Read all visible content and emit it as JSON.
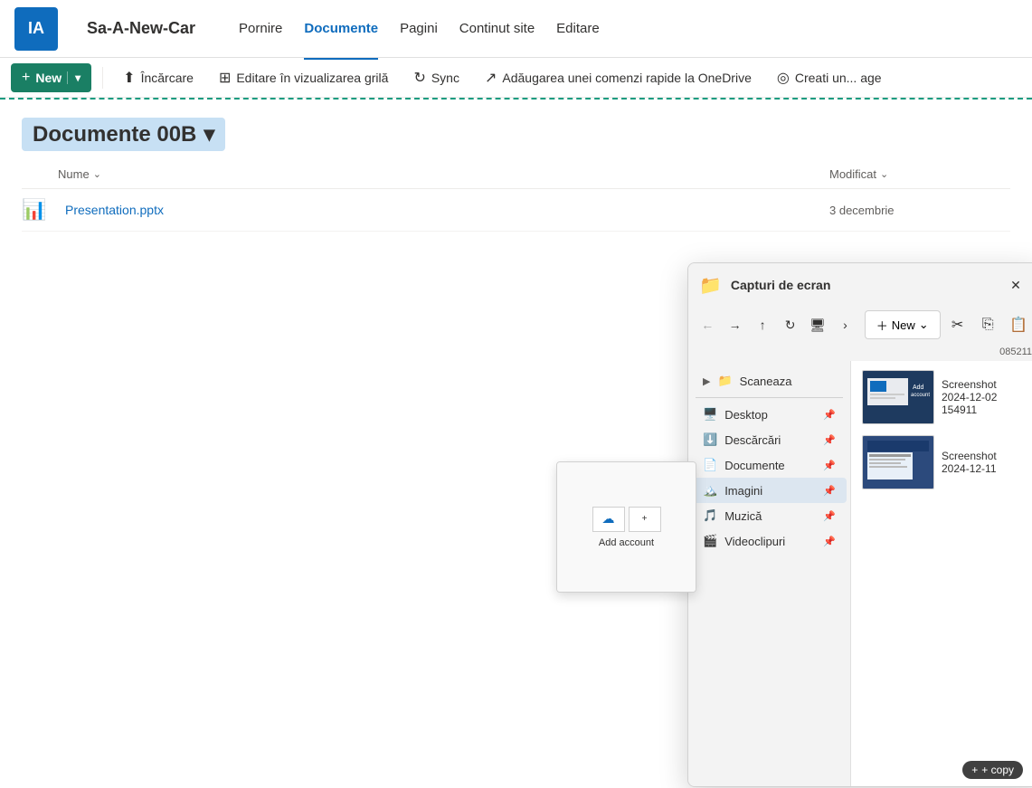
{
  "app": {
    "logo_text": "IA",
    "site_name": "Sa-A-New-Car"
  },
  "nav": {
    "items": [
      {
        "label": "Pornire",
        "active": false
      },
      {
        "label": "Documente",
        "active": true
      },
      {
        "label": "Pagini",
        "active": false
      },
      {
        "label": "Continut site",
        "active": false
      },
      {
        "label": "Editare",
        "active": false
      }
    ]
  },
  "commandbar": {
    "new_label": "New",
    "upload_label": "Încărcare",
    "edit_grid_label": "Editare în vizualizarea grilă",
    "sync_label": "Sync",
    "add_onedrive_label": "Adăugarea unei comenzi rapide la OneDrive",
    "create_agent_label": "Creati un... age"
  },
  "breadcrumb": {
    "label": "Documente 00B"
  },
  "file_list": {
    "columns": {
      "name": "Nume",
      "modified": "Modificat"
    },
    "files": [
      {
        "name": "Presentation.pptx",
        "modified": "3 decembrie",
        "type": "pptx"
      }
    ]
  },
  "explorer": {
    "title": "Capturi de ecran",
    "new_label": "New",
    "sidebar_items": [
      {
        "label": "Scaneaza",
        "icon": "📁",
        "pinned": false
      },
      {
        "label": "Desktop",
        "icon": "🖥️",
        "pinned": true
      },
      {
        "label": "Descărcări",
        "icon": "⬇️",
        "pinned": true
      },
      {
        "label": "Documente",
        "icon": "📄",
        "pinned": true
      },
      {
        "label": "Imagini",
        "icon": "🏔️",
        "pinned": true,
        "active": true
      },
      {
        "label": "Muzică",
        "icon": "🎵",
        "pinned": true
      },
      {
        "label": "Videoclipuri",
        "icon": "🎬",
        "pinned": true
      }
    ],
    "small_text": "085211",
    "screenshot1_label": "Screenshot\n2024-12-02\n154911",
    "screenshot2_label": "Screenshot\n2024-12-11"
  },
  "drag": {
    "copy_label": "+ copy"
  }
}
